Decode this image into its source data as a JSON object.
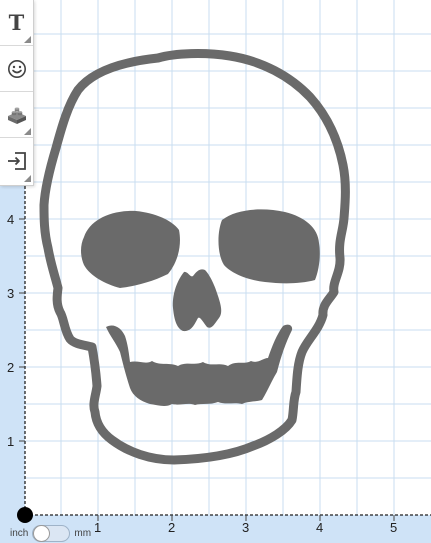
{
  "toolbar": {
    "tools": [
      {
        "name": "text-tool",
        "icon": "text-icon",
        "glyph": "T",
        "has_submenu": true
      },
      {
        "name": "emoji-tool",
        "icon": "smiley-icon",
        "has_submenu": false
      },
      {
        "name": "brick-tool",
        "icon": "brick-icon",
        "has_submenu": true
      },
      {
        "name": "import-tool",
        "icon": "import-icon",
        "has_submenu": true
      }
    ]
  },
  "ruler": {
    "x_labels": [
      "1",
      "2",
      "3",
      "4",
      "5"
    ],
    "y_labels": [
      "4",
      "3",
      "2",
      "1"
    ]
  },
  "units": {
    "left_label": "inch",
    "right_label": "mm",
    "selected": "inch"
  },
  "colors": {
    "ruler_band": "#cfe3f7",
    "grid_line": "#c9ddf0",
    "shape_fill": "#6a6a6a",
    "origin_dot": "#000000"
  }
}
